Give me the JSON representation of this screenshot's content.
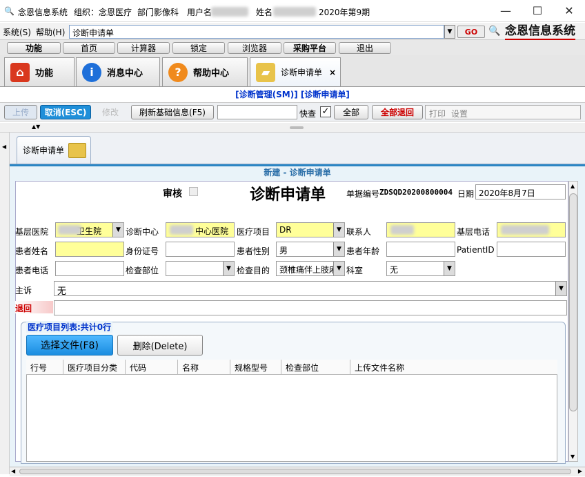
{
  "titlebar": {
    "app": "念恩信息系统",
    "org_label": "组织：",
    "org_value": "念恩医疗",
    "dept": "部门影像科",
    "user_label": "用户名",
    "name_label": "姓名",
    "period": "2020年第9期",
    "minimize": "—",
    "maximize": "☐",
    "close": "✕"
  },
  "menubar": {
    "system": "系统(S)",
    "help": "帮助(H)",
    "address": "诊断申请单",
    "go": "GO",
    "brand": "念恩信息系统"
  },
  "toolbar2": [
    "功能",
    "首页",
    "计算器",
    "锁定",
    "浏览器",
    "采购平台",
    "退出"
  ],
  "navtabs": [
    {
      "label": "功能",
      "icon": "home-icon"
    },
    {
      "label": "消息中心",
      "icon": "info-icon"
    },
    {
      "label": "帮助中心",
      "icon": "help-icon"
    },
    {
      "label": "诊断申请单",
      "icon": "folder-icon",
      "close": "×"
    }
  ],
  "crumb": "[诊断管理(SM)]  [诊断申请单]",
  "actionbar": {
    "upload": "上传",
    "cancel": "取消(ESC)",
    "edit": "修改",
    "refresh": "刷新基础信息(F5)",
    "quickcheck": "快查",
    "all": "全部",
    "all_return": "全部退回",
    "print": "打印",
    "settings": "设置"
  },
  "doctab": "诊断申请单",
  "panel_title": "新建 - 诊断申请单",
  "form": {
    "audit_label": "审核",
    "title": "诊断申请单",
    "docno_label": "单据编号",
    "docno": "ZDSQD20200800004",
    "date_label": "日期",
    "date": "2020年8月7日",
    "fields": {
      "base_hospital_label": "基层医院",
      "base_hospital": "卫生院",
      "center_label": "诊断中心",
      "center": "中心医院",
      "project_label": "医疗项目",
      "project": "DR",
      "contact_label": "联系人",
      "base_phone_label": "基层电话",
      "patient_name_label": "患者姓名",
      "id_label": "身份证号",
      "gender_label": "患者性别",
      "gender": "男",
      "age_label": "患者年龄",
      "pid_label": "PatientID",
      "phone_label": "患者电话",
      "part_label": "检查部位",
      "purpose_label": "检查目的",
      "purpose": "颈椎痛伴上肢麻",
      "dept_label": "科室",
      "dept": "无",
      "complaint_label": "主诉",
      "complaint": "无",
      "return_label": "退回"
    },
    "list_title": "医疗项目列表:共计0行",
    "select_file": "选择文件(F8)",
    "delete": "删除(Delete)",
    "columns": [
      "行号",
      "医疗项目分类",
      "代码",
      "名称",
      "规格型号",
      "检查部位",
      "上传文件名称"
    ]
  },
  "colors": {
    "accent": "#2c86c4",
    "yellow": "#ffff99",
    "cancel_bg": "#1f8fd9",
    "red": "#cc0000"
  }
}
